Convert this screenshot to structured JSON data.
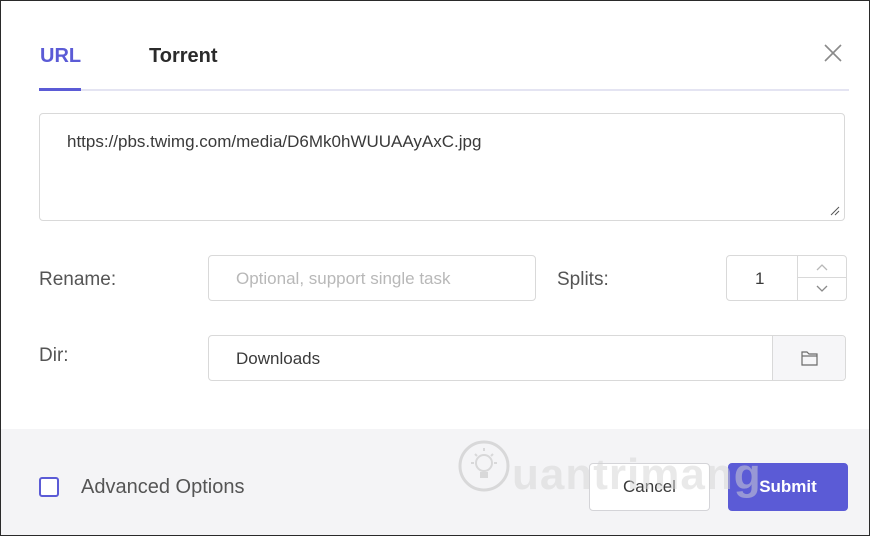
{
  "tabs": [
    {
      "label": "URL",
      "active": true
    },
    {
      "label": "Torrent",
      "active": false
    }
  ],
  "close_icon": "close-icon",
  "url_box": {
    "value": "https://pbs.twimg.com/media/D6Mk0hWUUAAyAxC.jpg"
  },
  "rename": {
    "label": "Rename:",
    "placeholder": "Optional, support single task",
    "value": ""
  },
  "splits": {
    "label": "Splits:",
    "value": "1"
  },
  "dir": {
    "label": "Dir:",
    "value": "Downloads",
    "browse_icon": "folder-icon"
  },
  "footer": {
    "advanced_label": "Advanced Options",
    "advanced_checked": false,
    "cancel_label": "Cancel",
    "submit_label": "Submit"
  },
  "watermark": {
    "text": "uantrimang"
  },
  "colors": {
    "accent": "#5b5bd6",
    "footer_bg": "#f4f4f6",
    "border": "#d9d9d9"
  }
}
